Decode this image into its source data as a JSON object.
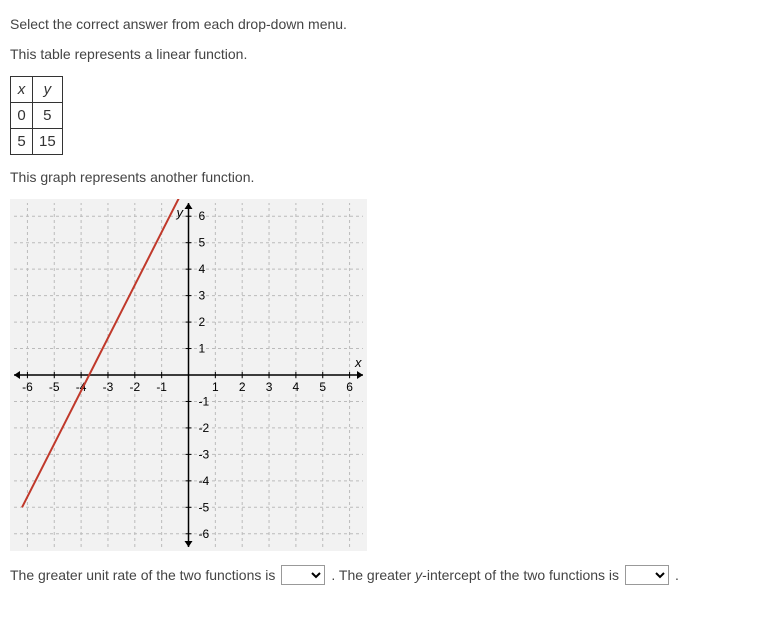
{
  "instruction": "Select the correct answer from each drop-down menu.",
  "table_intro": "This table represents a linear function.",
  "table": {
    "headers": {
      "x": "x",
      "y": "y"
    },
    "rows": [
      {
        "x": "0",
        "y": "5"
      },
      {
        "x": "5",
        "y": "15"
      }
    ]
  },
  "graph_intro": "This graph represents another function.",
  "chart_data": {
    "type": "line",
    "title": "",
    "xlabel": "x",
    "ylabel": "y",
    "xlim": [
      -6.5,
      6.5
    ],
    "ylim": [
      -6.5,
      6.5
    ],
    "x_ticks": [
      -6,
      -5,
      -4,
      -3,
      -2,
      -1,
      1,
      2,
      3,
      4,
      5,
      6
    ],
    "y_ticks": [
      -6,
      -5,
      -4,
      -3,
      -2,
      -1,
      1,
      2,
      3,
      4,
      5,
      6
    ],
    "grid": true,
    "grid_style": "dashed",
    "series": [
      {
        "name": "line",
        "color": "#c0392b",
        "points": [
          {
            "x": -6.2,
            "y": -5
          },
          {
            "x": -4.2,
            "y": -1
          },
          {
            "x": -3.7,
            "y": 0
          },
          {
            "x": -0.7,
            "y": 6
          },
          {
            "x": -0.35,
            "y": 6.7
          }
        ],
        "y_intercept": 7.4,
        "slope": 2
      }
    ]
  },
  "sentence": {
    "part1": "The greater unit rate of the two functions is",
    "part2a": ". The greater ",
    "y_letter": "y",
    "part2b": "-intercept of the two functions is",
    "part3": "."
  }
}
